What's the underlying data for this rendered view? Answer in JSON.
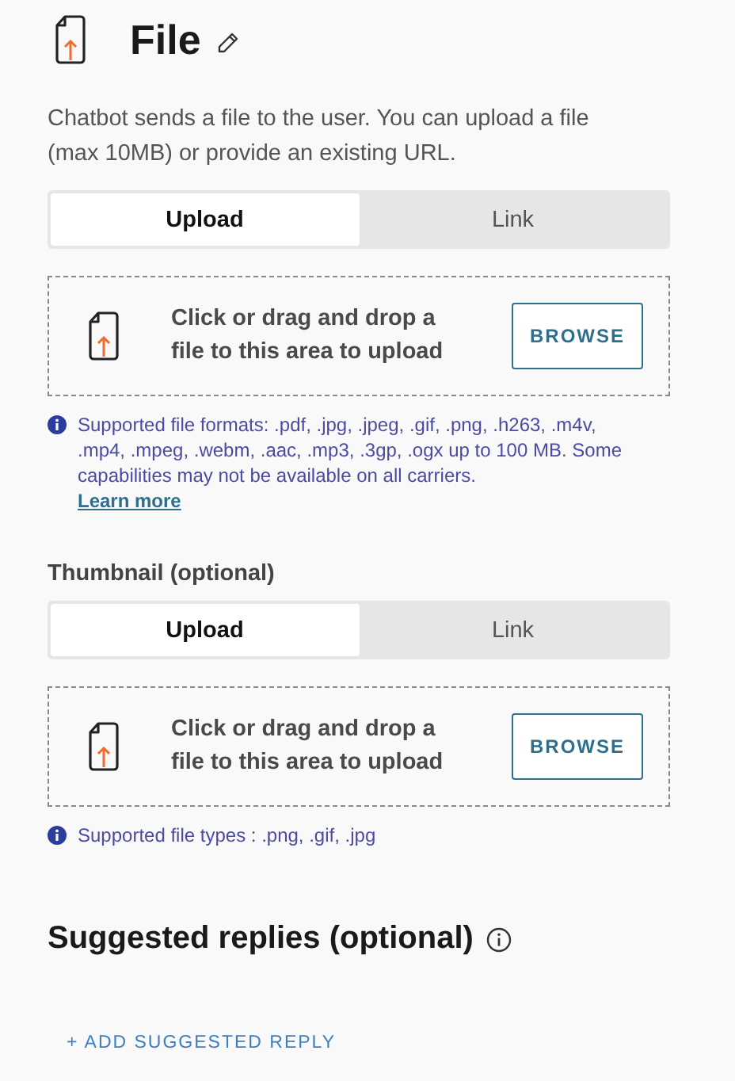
{
  "header": {
    "title": "File",
    "description": "Chatbot sends a file to the user. You can upload a file (max 10MB) or provide an existing URL."
  },
  "sections": [
    {
      "tabs": [
        {
          "label": "Upload",
          "selected": true
        },
        {
          "label": "Link",
          "selected": false
        }
      ],
      "dropzone": {
        "text": "Click or drag and drop a file to this area to upload",
        "button": "BROWSE"
      },
      "info": {
        "text": "Supported file formats: .pdf, .jpg, .jpeg, .gif, .png, .h263, .m4v, .mp4, .mpeg, .webm, .aac, .mp3, .3gp, .ogx up to 100 MB. Some capabilities may not be available on all carriers.",
        "link": "Learn more"
      }
    },
    {
      "label": "Thumbnail (optional)",
      "tabs": [
        {
          "label": "Upload",
          "selected": true
        },
        {
          "label": "Link",
          "selected": false
        }
      ],
      "dropzone": {
        "text": "Click or drag and drop a file to this area to upload",
        "button": "BROWSE"
      },
      "info": {
        "text": "Supported file types : .png, .gif, .jpg"
      }
    }
  ],
  "suggested_replies": {
    "title": "Suggested replies (optional)",
    "add_button": "+ ADD SUGGESTED REPLY"
  }
}
